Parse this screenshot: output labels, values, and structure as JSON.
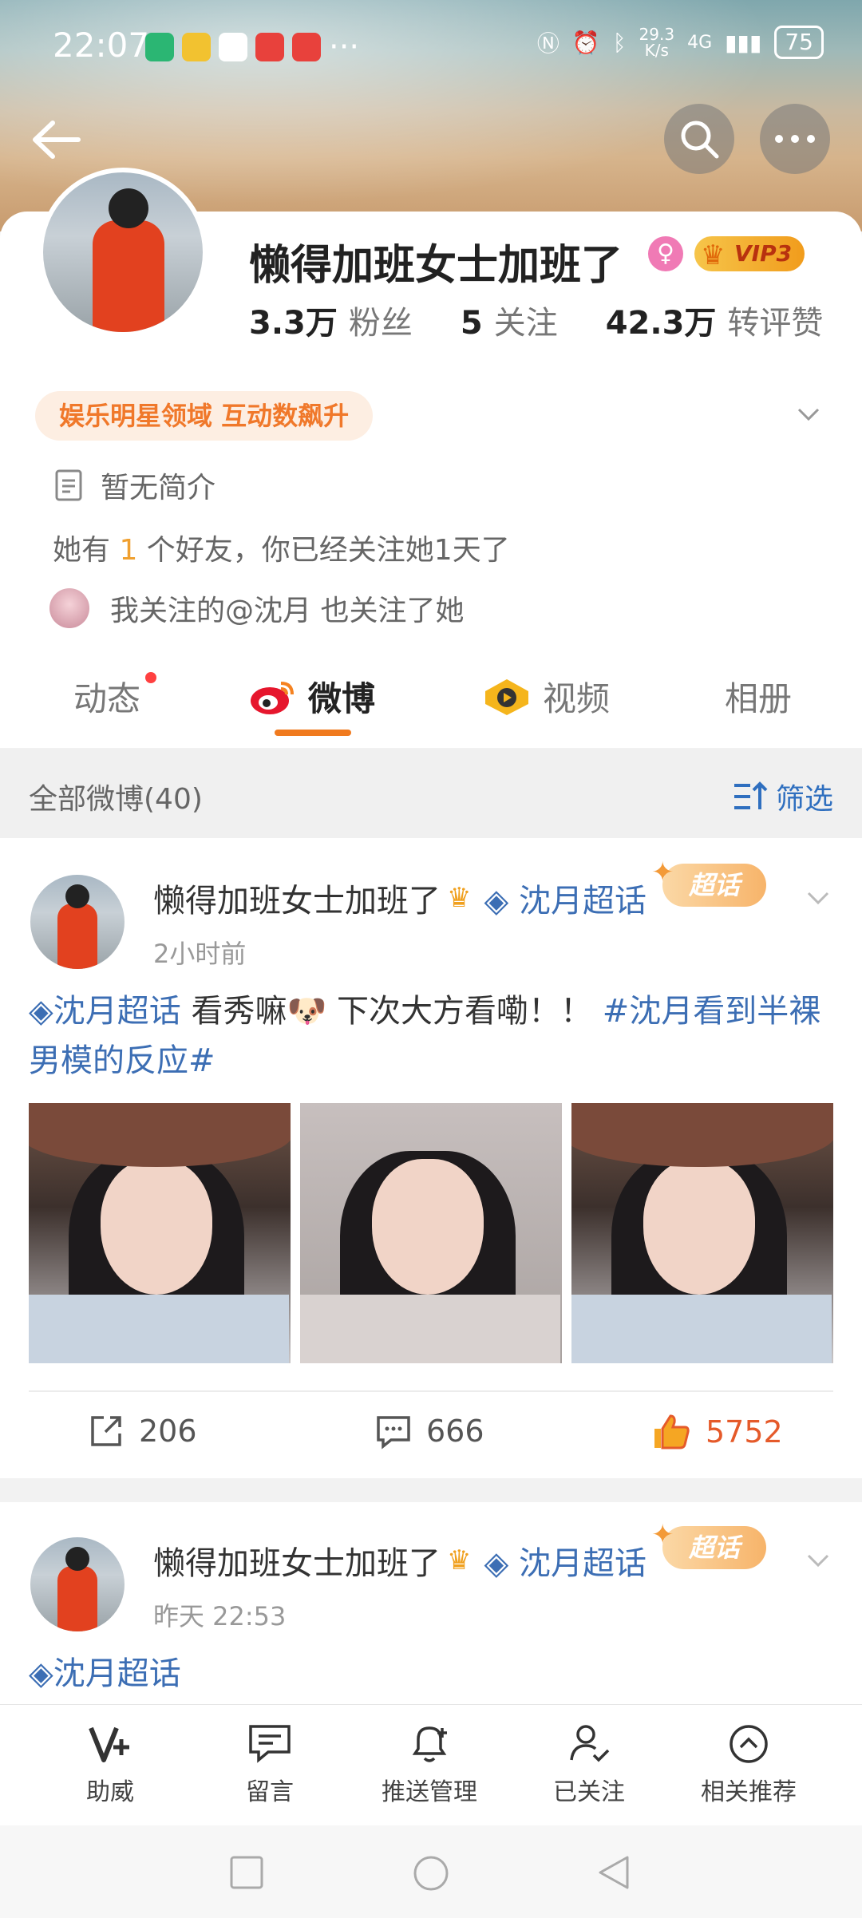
{
  "status_bar": {
    "time": "22:07",
    "speed": "29.3\nK/s",
    "network": "4G",
    "battery": "75",
    "more": "···"
  },
  "profile": {
    "nickname": "懒得加班女士加班了",
    "vip_label": "VIP3",
    "fans_count": "3.3万",
    "fans_label": "粉丝",
    "follow_count": "5",
    "follow_label": "关注",
    "likes_count": "42.3万",
    "likes_label": "转评赞",
    "field_tag": "娱乐明星领域 互动数飙升",
    "brief": "暂无简介",
    "friends_prefix": "她有 ",
    "friends_count": "1",
    "friends_suffix": " 个好友，你已经关注她1天了",
    "mutual": "我关注的@沈月 也关注了她"
  },
  "tabs": {
    "dynamic": "动态",
    "weibo": "微博",
    "video": "视频",
    "album": "相册"
  },
  "filter": {
    "all": "全部微博(40)",
    "select": "筛选"
  },
  "posts": [
    {
      "author": "懒得加班女士加班了",
      "topic": "沈月超话",
      "badge": "超话",
      "time": "2小时前",
      "text_topic": "沈月超话",
      "text_body": " 看秀嘛🐶 下次大方看嘞！！ ",
      "text_hashtag": "#沈月看到半裸男模的反应#",
      "reposts": "206",
      "comments": "666",
      "likes": "5752"
    },
    {
      "author": "懒得加班女士加班了",
      "topic": "沈月超话",
      "badge": "超话",
      "time": "昨天 22:53",
      "text_topic": "沈月超话"
    }
  ],
  "bottom_bar": {
    "zhuwei": "助威",
    "message": "留言",
    "push": "推送管理",
    "followed": "已关注",
    "recommend": "相关推荐"
  },
  "colors": {
    "accent_orange": "#f07a1e",
    "link_blue": "#3c6eb4",
    "like_red": "#e55a2a"
  }
}
